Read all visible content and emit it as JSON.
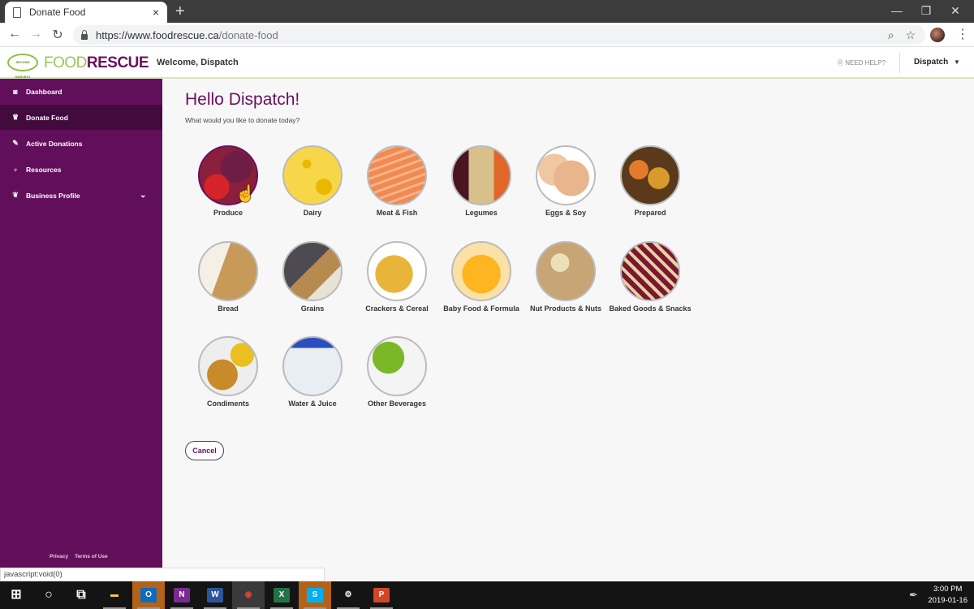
{
  "browser": {
    "tab_title": "Donate Food",
    "close_tab": "×",
    "new_tab": "+",
    "url_host": "https://www.foodrescue.ca",
    "url_path": "/donate-food",
    "window_controls": {
      "minimize": "—",
      "restore": "❐",
      "close": "✕"
    }
  },
  "header": {
    "logo_badge": "SECOND HARVEST",
    "logo_food": "FOOD",
    "logo_rescue": "RESCUE",
    "welcome": "Welcome, Dispatch",
    "need_help": "⓪ NEED HELP?",
    "user": "Dispatch",
    "user_caret": "▼"
  },
  "sidebar": {
    "items": [
      {
        "label": "Dashboard",
        "icon": "dashboard-icon",
        "glyph": "◙"
      },
      {
        "label": "Donate Food",
        "icon": "donate-food-icon",
        "glyph": "♛",
        "active": true
      },
      {
        "label": "Active Donations",
        "icon": "carrot-icon",
        "glyph": "✎"
      },
      {
        "label": "Resources",
        "icon": "resources-icon",
        "glyph": "♆"
      },
      {
        "label": "Business Profile",
        "icon": "leaf-icon",
        "glyph": "❦",
        "chevron": "⌄"
      }
    ],
    "footer": {
      "privacy": "Privacy",
      "terms": "Terms of Use"
    }
  },
  "main": {
    "heading": "Hello Dispatch!",
    "subheading": "What would you like to donate today?",
    "categories": [
      {
        "label": "Produce",
        "icon": "produce-image",
        "hovered": true
      },
      {
        "label": "Dairy",
        "icon": "dairy-image"
      },
      {
        "label": "Meat & Fish",
        "icon": "meat-fish-image"
      },
      {
        "label": "Legumes",
        "icon": "legumes-image"
      },
      {
        "label": "Eggs & Soy",
        "icon": "eggs-soy-image"
      },
      {
        "label": "Prepared",
        "icon": "prepared-image"
      },
      {
        "label": "Bread",
        "icon": "bread-image"
      },
      {
        "label": "Grains",
        "icon": "grains-image"
      },
      {
        "label": "Crackers & Cereal",
        "icon": "crackers-cereal-image"
      },
      {
        "label": "Baby Food & Formula",
        "icon": "baby-food-image"
      },
      {
        "label": "Nut Products & Nuts",
        "icon": "nut-products-image"
      },
      {
        "label": "Baked Goods & Snacks",
        "icon": "baked-goods-image"
      },
      {
        "label": "Condiments",
        "icon": "condiments-image"
      },
      {
        "label": "Water & Juice",
        "icon": "water-juice-image"
      },
      {
        "label": "Other Beverages",
        "icon": "other-beverages-image"
      }
    ],
    "cancel_label": "Cancel"
  },
  "status_bar": {
    "url": "javascript:void(0)"
  },
  "taskbar": {
    "apps": [
      {
        "name": "start",
        "glyph": "⊞"
      },
      {
        "name": "cortana",
        "glyph": "○"
      },
      {
        "name": "task-view",
        "glyph": "⧉"
      },
      {
        "name": "file-explorer",
        "glyph": "▬"
      },
      {
        "name": "outlook",
        "glyph": "O"
      },
      {
        "name": "onenote",
        "glyph": "N"
      },
      {
        "name": "word",
        "glyph": "W"
      },
      {
        "name": "chrome",
        "glyph": "◉"
      },
      {
        "name": "excel",
        "glyph": "X"
      },
      {
        "name": "skype",
        "glyph": "S"
      },
      {
        "name": "settings",
        "glyph": "⚙"
      },
      {
        "name": "powerpoint",
        "glyph": "P"
      }
    ],
    "time": "3:00 PM",
    "date": "2019-01-16"
  }
}
